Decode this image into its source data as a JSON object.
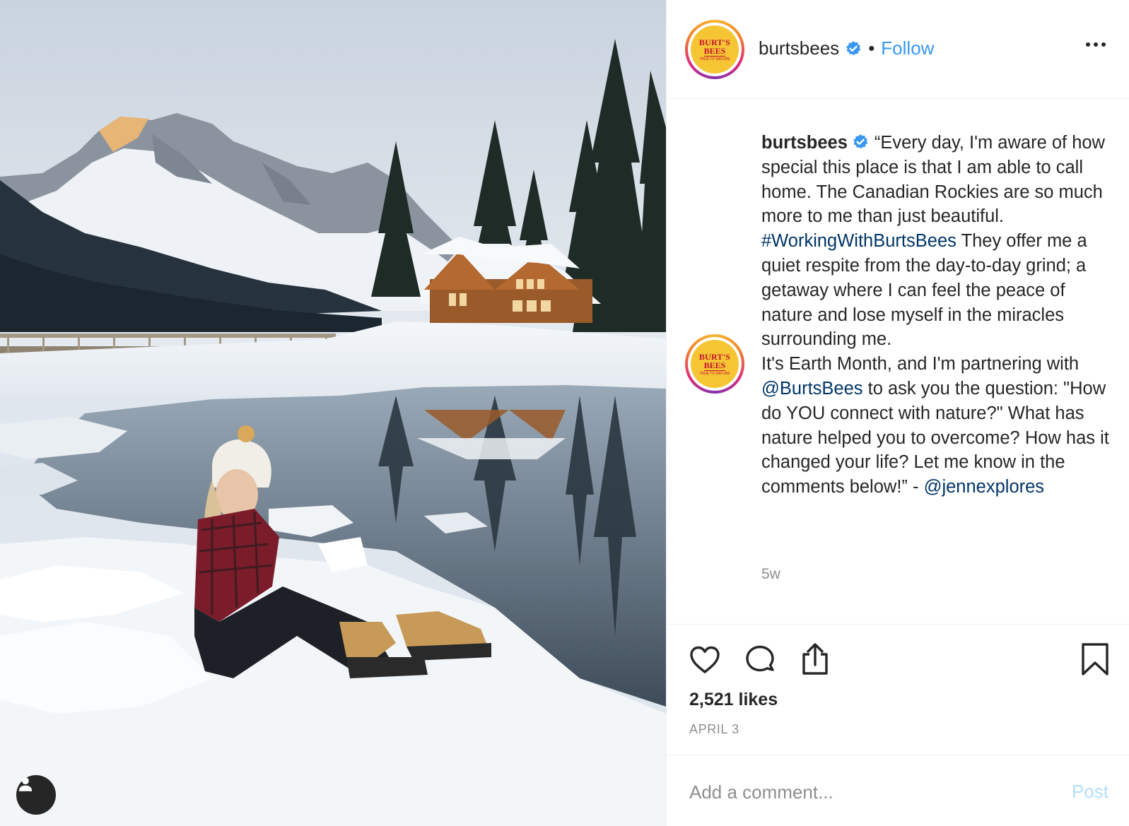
{
  "post": {
    "account": {
      "username": "burtsbees",
      "verified": true,
      "separator": "•",
      "follow_label": "Follow",
      "logo": {
        "line1": "BURT'S",
        "line2": "BEES",
        "line3": "TRUE TO NATURE"
      }
    },
    "caption": {
      "username": "burtsbees",
      "segments": [
        {
          "type": "text",
          "text": "“Every day, I'm aware of how special this place is that I am able to call home. The Canadian Rockies are so much more to me than just beautiful. "
        },
        {
          "type": "link",
          "text": "#WorkingWithBurtsBees"
        },
        {
          "type": "text",
          "text": " They offer me a quiet respite from the day-to-day grind; a getaway where I can feel the peace of nature and lose myself in the miracles surrounding me."
        },
        {
          "type": "break"
        },
        {
          "type": "text",
          "text": "It's Earth Month, and I'm partnering with "
        },
        {
          "type": "link",
          "text": "@BurtsBees"
        },
        {
          "type": "text",
          "text": " to ask you the question: \"How do YOU connect with nature?\" What has nature helped you to overcome? How has it changed your life? Let me know in the comments below!” - "
        },
        {
          "type": "link",
          "text": "@jennexplores"
        }
      ],
      "time_ago": "5w"
    },
    "stats": {
      "likes": "2,521 likes",
      "date": "APRIL 3"
    },
    "comment": {
      "placeholder": "Add a comment...",
      "post_label": "Post"
    },
    "icons": {
      "verified": "verified-badge-icon",
      "more": "more-options-icon",
      "like": "heart-icon",
      "comment": "comment-bubble-icon",
      "share": "share-icon",
      "save": "bookmark-icon",
      "tagged": "user-tag-icon"
    },
    "colors": {
      "link": "#003569",
      "follow": "#3897f0",
      "muted": "#8e8e8e",
      "post_disabled": "#b2dffc",
      "logo_yellow": "#f6c534",
      "logo_red": "#c4122f"
    }
  }
}
